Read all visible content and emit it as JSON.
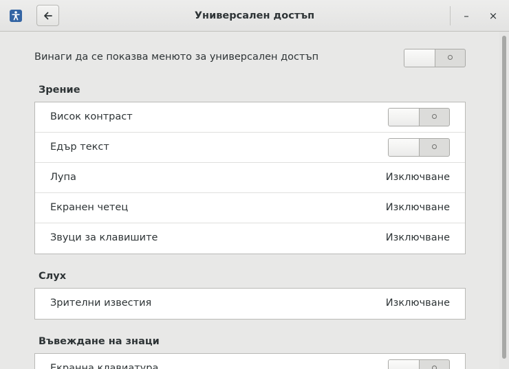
{
  "window": {
    "title": "Универсален достъп",
    "minimize_glyph": "–",
    "close_glyph": "×",
    "icons": {
      "app": "accessibility-icon",
      "back": "arrow-left-icon"
    }
  },
  "always_show": {
    "label": "Винаги да се показва менюто за универсален достъп",
    "state": "off"
  },
  "sections": {
    "seeing": {
      "heading": "Зрение",
      "rows": [
        {
          "label": "Висок контраст",
          "type": "switch",
          "state": "off"
        },
        {
          "label": "Едър текст",
          "type": "switch",
          "state": "off"
        },
        {
          "label": "Лупа",
          "type": "value",
          "value": "Изключване"
        },
        {
          "label": "Екранен четец",
          "type": "value",
          "value": "Изключване"
        },
        {
          "label": "Звуци за клавишите",
          "type": "value",
          "value": "Изключване"
        }
      ]
    },
    "hearing": {
      "heading": "Слух",
      "rows": [
        {
          "label": "Зрителни известия",
          "type": "value",
          "value": "Изключване"
        }
      ]
    },
    "typing": {
      "heading": "Въвеждане на знаци",
      "rows": [
        {
          "label": "Екранна клавиатура",
          "type": "switch",
          "state": "off"
        }
      ]
    }
  }
}
